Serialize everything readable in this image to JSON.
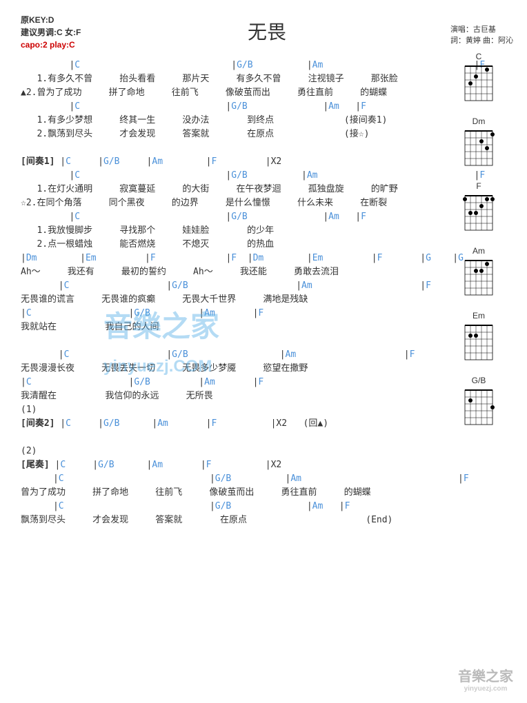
{
  "header": {
    "originalKey": "原KEY:D",
    "suggestion": "建议男调:C 女:F",
    "capo": "capo:2 play:C",
    "title": "无畏",
    "singer": "演唱：古巨基",
    "credits": "詞：黄婷   曲：阿沁"
  },
  "lines": [
    {
      "t": "c",
      "v": "         |C                            |G/B          |Am                            |F"
    },
    {
      "t": "l",
      "v": "   1.有多久不曾     抬头看看     那片天     有多久不曾     注视镜子     那张脸"
    },
    {
      "t": "l",
      "v": "▲2.曾为了成功     拼了命地     往前飞     像破茧而出     勇往直前     的蝴蝶"
    },
    {
      "t": "c",
      "v": "         |C                           |G/B              |Am   |F"
    },
    {
      "t": "l",
      "v": "   1.有多少梦想     终其一生     没办法       到终点             (接间奏1)"
    },
    {
      "t": "l",
      "v": "   2.飘荡到尽头     才会发现     答案就       在原点             (接☆)"
    },
    {
      "t": "b",
      "v": ""
    },
    {
      "t": "s",
      "v": "[间奏1] |C     |G/B     |Am        |F         |X2"
    },
    {
      "t": "c",
      "v": "         |C                           |G/B          |Am                             |F"
    },
    {
      "t": "l",
      "v": "   1.在灯火通明     寂寞蔓延     的大街     在午夜梦迴     孤独盘旋     的旷野"
    },
    {
      "t": "l",
      "v": "☆2.在同个角落     同个黑夜     的边界     是什么憧憬     什么未来     在断裂"
    },
    {
      "t": "c",
      "v": "         |C                           |G/B              |Am   |F"
    },
    {
      "t": "l",
      "v": "   1.我放慢脚步     寻找那个     娃娃脸       的少年"
    },
    {
      "t": "l",
      "v": "   2.点一根蜡烛     能否燃烧     不熄灭       的热血"
    },
    {
      "t": "c",
      "v": "|Dm        |Em         |F             |F  |Dm        |Em         |F       |G    |G"
    },
    {
      "t": "l",
      "v": "Ah～     我还有     最初的誓约     Ah～     我还能     勇敢去流泪"
    },
    {
      "t": "c",
      "v": "       |C                  |G/B                    |Am                    |F"
    },
    {
      "t": "l",
      "v": "无畏谁的谎言     无畏谁的疯癫     无畏大千世界     满地是残缺"
    },
    {
      "t": "c",
      "v": "|C                  |G/B         |Am       |F"
    },
    {
      "t": "l",
      "v": "我就站在         我自己的人间"
    },
    {
      "t": "b",
      "v": ""
    },
    {
      "t": "c",
      "v": "       |C                  |G/B                 |Am                    |F"
    },
    {
      "t": "l",
      "v": "无畏漫漫长夜     无畏丢失一切     无畏多少梦魇     慾望在撒野"
    },
    {
      "t": "c",
      "v": "|C                  |G/B         |Am       |F"
    },
    {
      "t": "l",
      "v": "我清醒在         我信仰的永远     无所畏"
    },
    {
      "t": "l",
      "v": "(1)"
    },
    {
      "t": "s",
      "v": "[间奏2] |C     |G/B      |Am       |F          |X2   (回▲)"
    },
    {
      "t": "b",
      "v": ""
    },
    {
      "t": "l",
      "v": "(2)"
    },
    {
      "t": "s",
      "v": "[尾奏] |C     |G/B      |Am       |F          |X2"
    },
    {
      "t": "c",
      "v": "      |C                           |G/B          |Am                             |F"
    },
    {
      "t": "l",
      "v": "曾为了成功     拼了命地     往前飞     像破茧而出     勇往直前     的蝴蝶"
    },
    {
      "t": "c",
      "v": "      |C                           |G/B              |Am   |F"
    },
    {
      "t": "l",
      "v": "飘荡到尽头     才会发现     答案就       在原点                      (End)"
    }
  ],
  "chords": [
    "C",
    "Dm",
    "F",
    "Am",
    "Em",
    "G/B"
  ],
  "watermark": "音樂之家",
  "watermarkUrl": "yinyuezj.COM",
  "footer": "音樂之家",
  "footerUrl": "yinyuezj.com"
}
